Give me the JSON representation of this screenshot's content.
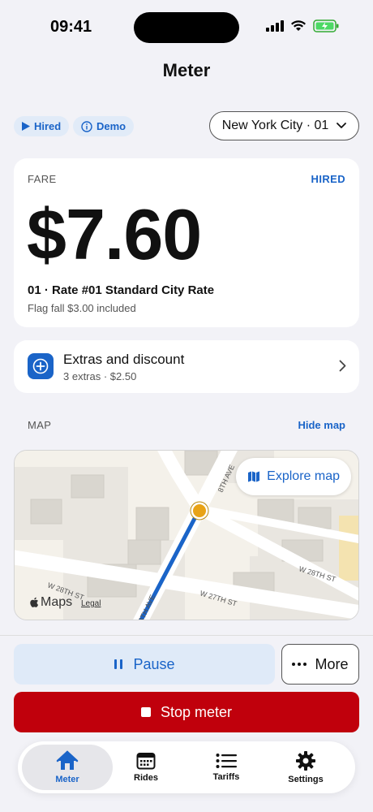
{
  "status_bar": {
    "time": "09:41"
  },
  "nav": {
    "title": "Meter"
  },
  "chips": {
    "hired": "Hired",
    "demo": "Demo"
  },
  "city_select": {
    "value": "New York City · 01"
  },
  "fare": {
    "label": "FARE",
    "status": "HIRED",
    "amount": "$7.60",
    "rate": "01 · Rate #01 Standard City Rate",
    "flag_fall": "Flag fall $3.00 included"
  },
  "extras": {
    "title": "Extras and discount",
    "subtitle": "3 extras · $2.50"
  },
  "map": {
    "label": "MAP",
    "hide_label": "Hide map",
    "explore_label": "Explore map",
    "brand": "Maps",
    "legal": "Legal",
    "streets": [
      "8TH AVE",
      "W 28TH ST",
      "W 27TH ST",
      "W 28TH ST",
      "8TH AVE"
    ]
  },
  "controls": {
    "pause": "Pause",
    "more": "More",
    "stop": "Stop meter"
  },
  "tabs": [
    {
      "label": "Meter",
      "icon": "home-icon"
    },
    {
      "label": "Rides",
      "icon": "calendar-icon"
    },
    {
      "label": "Tariffs",
      "icon": "list-icon"
    },
    {
      "label": "Settings",
      "icon": "gear-icon"
    }
  ],
  "colors": {
    "accent": "#1a64c8",
    "danger": "#c0000c",
    "route": "#1a64c8",
    "location_dot": "#e8a317"
  }
}
